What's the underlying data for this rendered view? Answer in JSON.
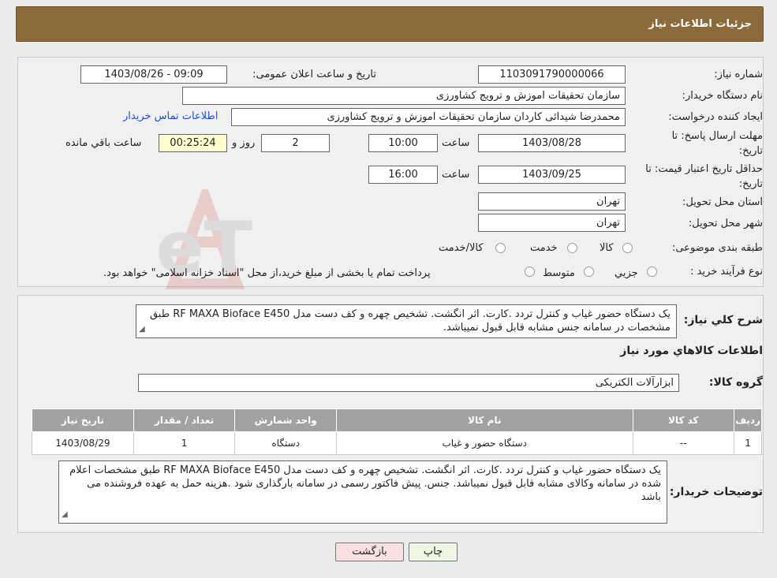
{
  "header": {
    "title": "جزئیات اطلاعات نیاز"
  },
  "form": {
    "need_number_label": "شماره نیاز:",
    "need_number": "1103091790000066",
    "announce_label": "تاریخ و ساعت اعلان عمومی:",
    "announce_value": "1403/08/26 - 09:09",
    "buyer_org_label": "نام دستگاه خریدار:",
    "buyer_org": "سازمان تحقیقات  اموزش و ترویج کشاورزی",
    "creator_label": "ایجاد کننده درخواست:",
    "creator": "محمدرضا شیدائی کاردان سازمان تحقیقات  اموزش و ترویج کشاورزی",
    "contact_link": "اطلاعات تماس خریدار",
    "deadline_label_1": "مهلت ارسال پاسخ: تا",
    "deadline_label_2": "تاریخ:",
    "deadline_date": "1403/08/28",
    "time_label": "ساعت",
    "deadline_time": "10:00",
    "days_value": "2",
    "days_label": "روز و",
    "remaining_value": "00:25:24",
    "remaining_label": "ساعت باقي مانده",
    "validity_label_1": "حداقل تاریخ اعتبار قیمت: تا",
    "validity_label_2": "تاریخ:",
    "validity_date": "1403/09/25",
    "validity_time": "16:00",
    "province_label": "استان محل تحویل:",
    "province": "تهران",
    "city_label": "شهر محل تحویل:",
    "city": "تهران",
    "category_label": "طبقه بندی موضوعی:",
    "category_options": [
      "کالا",
      "خدمت",
      "کالا/خدمت"
    ],
    "process_label": "نوع فرآیند خرید :",
    "process_options": [
      "جزیي",
      "متوسط"
    ],
    "process_note": "پرداخت تمام یا بخشی از مبلغ خرید،از محل \"اسناد خزانه اسلامی\" خواهد بود."
  },
  "summary": {
    "label": "شرح کلي نیاز:",
    "text": "یک دستگاه حضور غیاب و کنترل تردد .کارت. اثر انگشت. تشخیص چهره و کف دست مدل  RF MAXA Bioface E450 طبق مشخصات در سامانه جنس مشابه قابل قبول نمیباشد."
  },
  "goods": {
    "section_title": "اطلاعات کالاهاي مورد نیاز",
    "group_label": "گروه کالا:",
    "group_value": "ابزارآلات الکتریکی",
    "table_headers": [
      "ردیف",
      "کد کالا",
      "نام کالا",
      "واحد شمارش",
      "تعداد / مقدار",
      "تاریخ نیاز"
    ],
    "rows": [
      [
        "1",
        "--",
        "دستگاه حضور و غیاب",
        "دستگاه",
        "1",
        "1403/08/29"
      ]
    ]
  },
  "buyer_notes": {
    "label": "توضیحات خریدار:",
    "text": "یک دستگاه حضور غیاب و کنترل تردد .کارت. اثر انگشت. تشخیص چهره و کف دست مدل  RF MAXA Bioface E450 طبق مشخصات اعلام شده در سامانه وکالای مشابه قابل قبول نمیباشد. جنس. پیش فاکتور رسمی در سامانه بارگذاری شود .هزینه حمل به عهده فروشنده می باشد"
  },
  "buttons": {
    "print": "چاپ",
    "back": "بازگشت"
  },
  "colors": {
    "header_bg": "#8d6a3a",
    "back_button_bg": "#fbe0e0",
    "print_button_bg": "#eef7e4",
    "link": "#1a4fd6"
  }
}
